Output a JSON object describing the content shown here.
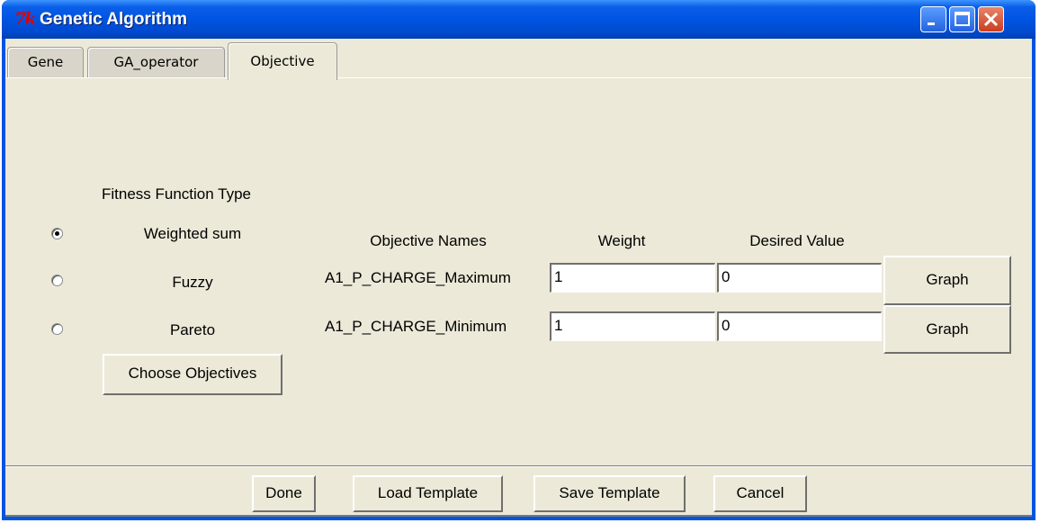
{
  "window": {
    "title": "Genetic Algorithm",
    "icon_text": "7k"
  },
  "tabs": [
    {
      "label": "Gene",
      "active": false
    },
    {
      "label": "GA_operator",
      "active": false
    },
    {
      "label": "Objective",
      "active": true
    }
  ],
  "fitness": {
    "heading": "Fitness Function Type",
    "options": [
      {
        "label": "Weighted sum",
        "selected": true
      },
      {
        "label": "Fuzzy",
        "selected": false
      },
      {
        "label": "Pareto",
        "selected": false
      }
    ],
    "choose_button": "Choose Objectives"
  },
  "objectives": {
    "headers": {
      "names": "Objective Names",
      "weight": "Weight",
      "desired": "Desired Value"
    },
    "rows": [
      {
        "name": "A1_P_CHARGE_Maximum",
        "weight": "1",
        "desired": "0",
        "graph_label": "Graph"
      },
      {
        "name": "A1_P_CHARGE_Minimum",
        "weight": "1",
        "desired": "0",
        "graph_label": "Graph"
      }
    ]
  },
  "footer": {
    "done": "Done",
    "load_template": "Load Template",
    "save_template": "Save Template",
    "cancel": "Cancel"
  },
  "colors": {
    "titlebar": "#0054e3",
    "client_bg": "#ece9d8",
    "close_button": "#cc3d1e"
  }
}
